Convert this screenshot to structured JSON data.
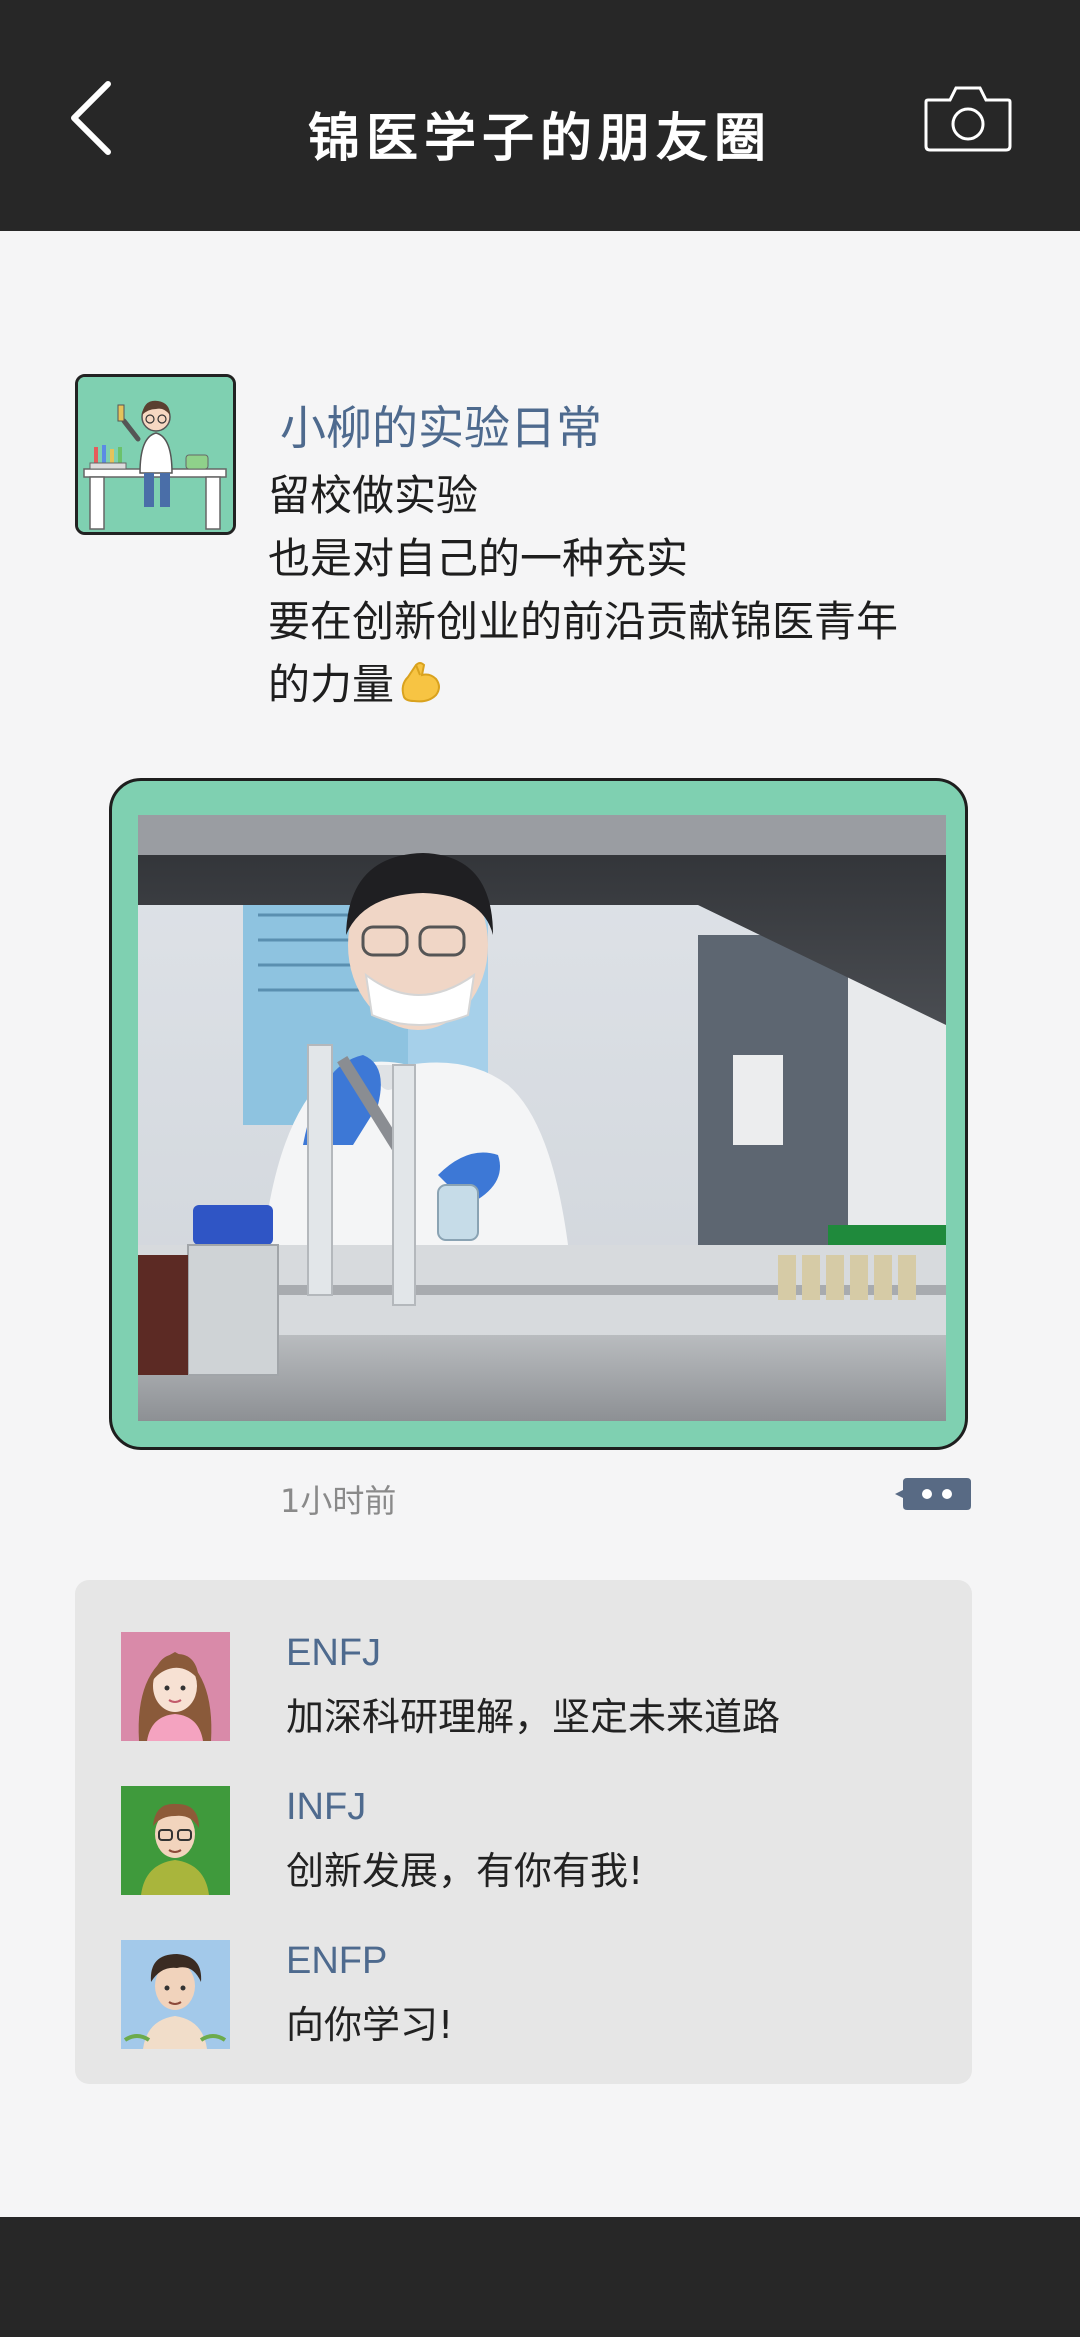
{
  "header": {
    "title": "锦医学子的朋友圈",
    "back_icon": "chevron-left-icon",
    "camera_icon": "camera-icon"
  },
  "post": {
    "author": "小柳的实验日常",
    "lines": [
      "留校做实验",
      "也是对自己的一种充实",
      "要在创新创业的前沿贡献锦医青年",
      "的力量"
    ],
    "emoji": "flexed-biceps-emoji",
    "time": "1小时前",
    "more_icon": "more-dots-icon"
  },
  "comments": [
    {
      "name": "ENFJ",
      "text": "加深科研理解，坚定未来道路"
    },
    {
      "name": "INFJ",
      "text": "创新发展，有你有我!"
    },
    {
      "name": "ENFP",
      "text": "向你学习!"
    }
  ],
  "colors": {
    "bar": "#272727",
    "accent_green": "#7fd0b1",
    "name_blue": "#4e6a8e",
    "comment_bg": "#e6e6e6",
    "page_bg": "#f5f5f6"
  }
}
